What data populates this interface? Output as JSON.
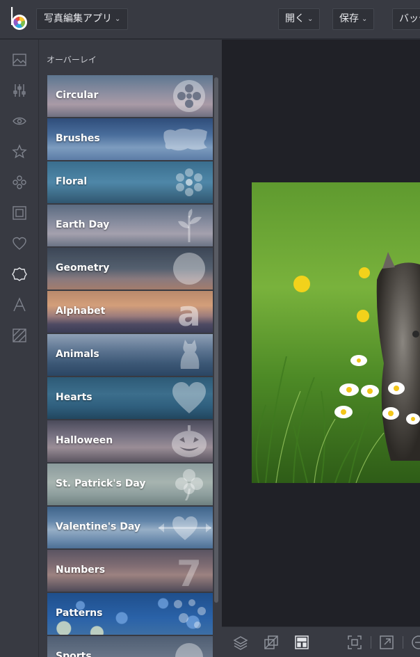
{
  "header": {
    "app_selector": "写真編集アプリ",
    "open_label": "開く",
    "save_label": "保存",
    "batch_label": "バッチ"
  },
  "sidebar_rail": {
    "icons": [
      "image-icon",
      "sliders-icon",
      "eye-icon",
      "star-icon",
      "effects-icon",
      "frame-icon",
      "heart-icon",
      "overlay-icon",
      "text-icon",
      "texture-icon"
    ],
    "active": "overlay-icon"
  },
  "panel": {
    "title": "オーバーレイ",
    "items": [
      {
        "label": "Circular",
        "icon": "flower-circle-icon"
      },
      {
        "label": "Brushes",
        "icon": "brush-stroke-icon"
      },
      {
        "label": "Floral",
        "icon": "flower-icon"
      },
      {
        "label": "Earth Day",
        "icon": "plant-icon"
      },
      {
        "label": "Geometry",
        "icon": "circle-icon"
      },
      {
        "label": "Alphabet",
        "icon": "letter-a-icon"
      },
      {
        "label": "Animals",
        "icon": "cat-icon"
      },
      {
        "label": "Hearts",
        "icon": "heart-icon"
      },
      {
        "label": "Halloween",
        "icon": "pumpkin-icon"
      },
      {
        "label": "St. Patrick's Day",
        "icon": "clover-icon"
      },
      {
        "label": "Valentine's Day",
        "icon": "heart-arrow-icon"
      },
      {
        "label": "Numbers",
        "icon": "number-seven-icon"
      },
      {
        "label": "Patterns",
        "icon": "dots-pattern-icon"
      },
      {
        "label": "Sports",
        "icon": "sports-icon"
      }
    ]
  },
  "bottom_toolbar": {
    "icons": [
      "layers-icon",
      "compare-icon",
      "layout-icon",
      "fit-screen-icon",
      "open-external-icon",
      "zoom-out-icon"
    ],
    "active": "layout-icon"
  },
  "colors": {
    "chrome": "#383a42",
    "canvas": "#202127",
    "text": "#e9eaee",
    "muted_icon": "#7f838d"
  }
}
